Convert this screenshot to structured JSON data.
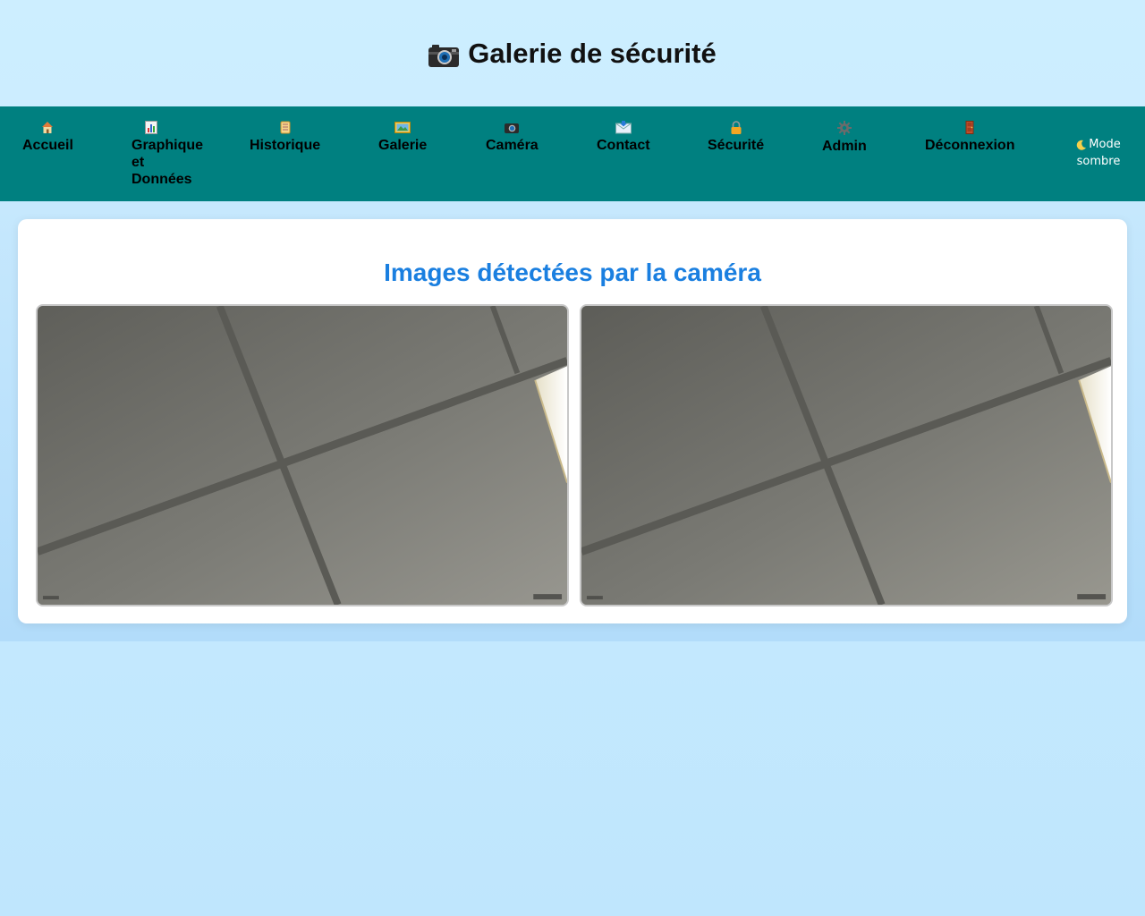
{
  "header": {
    "title": "Galerie de sécurité",
    "icon": "camera-icon"
  },
  "nav": {
    "items": [
      {
        "label": "Accueil",
        "icon": "house-icon"
      },
      {
        "label": "Graphique et Données",
        "label_lines": [
          "Graphique",
          "et",
          "Données"
        ],
        "icon": "chart-icon"
      },
      {
        "label": "Historique",
        "icon": "scroll-icon"
      },
      {
        "label": "Galerie",
        "icon": "picture-icon"
      },
      {
        "label": "Caméra",
        "icon": "camera-icon"
      },
      {
        "label": "Contact",
        "icon": "envelope-icon"
      },
      {
        "label": "Sécurité",
        "icon": "lock-icon"
      },
      {
        "label": "Admin",
        "icon": "gear-icon"
      },
      {
        "label": "Déconnexion",
        "icon": "door-icon"
      }
    ],
    "dark_mode": {
      "label_lines": [
        "Mode",
        "sombre"
      ],
      "icon": "moon-icon"
    }
  },
  "gallery": {
    "heading": "Images détectées par la caméra",
    "images": [
      {
        "alt": "ceiling-tiles-photo-1"
      },
      {
        "alt": "ceiling-tiles-photo-2"
      }
    ]
  },
  "colors": {
    "nav_bg": "#008080",
    "heading": "#1a7fe0",
    "page_bg": "#cdeeff"
  }
}
